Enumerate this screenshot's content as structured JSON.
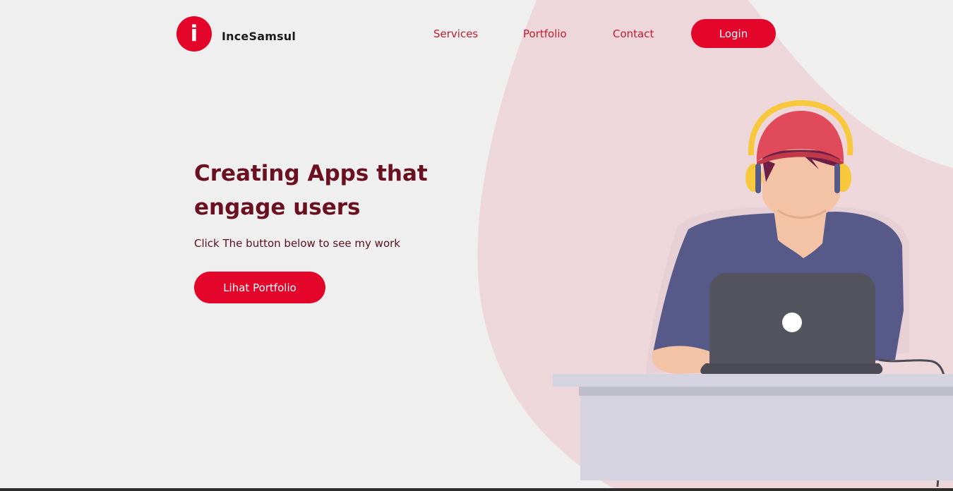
{
  "header": {
    "logo_letter": "i",
    "brand_name": "InceSamsul",
    "nav": [
      {
        "label": "Services"
      },
      {
        "label": "Portfolio"
      },
      {
        "label": "Contact"
      }
    ],
    "login_label": "Login"
  },
  "hero": {
    "title_line1": "Creating Apps that",
    "title_line2": "engage users",
    "subtitle": "Click The button below to see my work",
    "cta_label": "Lihat Portfolio"
  },
  "illustration": {
    "icon": "person-with-laptop-illustration"
  },
  "colors": {
    "accent": "#e3052a",
    "title": "#6a1020",
    "nav_text": "#c21a2f",
    "background": "#efefef",
    "blob": "#eed7db"
  }
}
